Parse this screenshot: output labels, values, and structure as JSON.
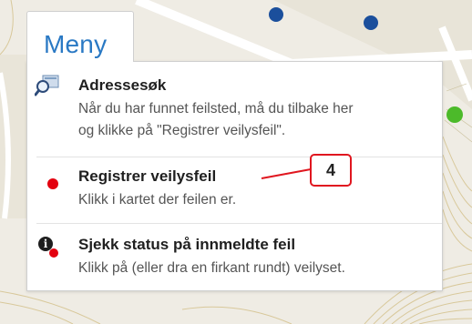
{
  "tab": {
    "label": "Meny"
  },
  "menu": {
    "items": [
      {
        "title": "Adressesøk",
        "desc_lines": [
          "Når du har funnet feilsted, må du tilbake her",
          "og klikke på \"Registrer veilysfeil\"."
        ],
        "icon": "search-magnifier-icon"
      },
      {
        "title": "Registrer veilysfeil",
        "desc_lines": [
          "Klikk i kartet der feilen er."
        ],
        "icon": "red-dot-icon"
      },
      {
        "title": "Sjekk status på innmeldte feil",
        "desc_lines": [
          "Klikk på (eller dra en firkant rundt) veilyset."
        ],
        "icon": "info-icon"
      }
    ]
  },
  "callout": {
    "label": "4"
  },
  "colors": {
    "accent": "#2a79c4",
    "marker_red": "#e3000f",
    "callout_red": "#e0161f",
    "map_dot_blue": "#1b4f9c",
    "map_dot_green": "#4cba2a"
  }
}
